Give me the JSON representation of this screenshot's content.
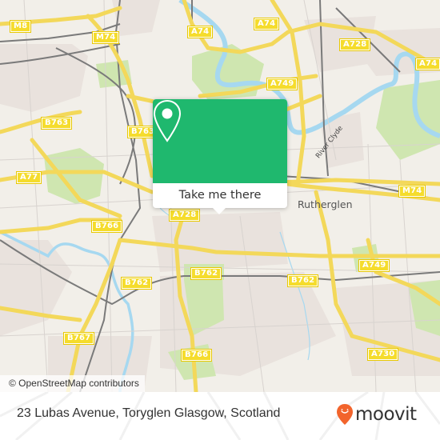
{
  "map": {
    "attribution": "© OpenStreetMap contributors",
    "road_labels": [
      {
        "id": "m8",
        "text": "M8"
      },
      {
        "id": "m74-nw",
        "text": "M74"
      },
      {
        "id": "a74-n",
        "text": "A74"
      },
      {
        "id": "a74-top",
        "text": "A74"
      },
      {
        "id": "a728-ne",
        "text": "A728"
      },
      {
        "id": "a74-ne",
        "text": "A74"
      },
      {
        "id": "a749-n",
        "text": "A749"
      },
      {
        "id": "b763-w",
        "text": "B763"
      },
      {
        "id": "b763-c",
        "text": "B763"
      },
      {
        "id": "a77",
        "text": "A77"
      },
      {
        "id": "m74-e",
        "text": "M74"
      },
      {
        "id": "a728-c",
        "text": "A728"
      },
      {
        "id": "b766-w",
        "text": "B766"
      },
      {
        "id": "a749-se",
        "text": "A749"
      },
      {
        "id": "b762-w",
        "text": "B762"
      },
      {
        "id": "b762-c",
        "text": "B762"
      },
      {
        "id": "b762-e",
        "text": "B762"
      },
      {
        "id": "b767",
        "text": "B767"
      },
      {
        "id": "b766-s",
        "text": "B766"
      },
      {
        "id": "a730",
        "text": "A730"
      }
    ],
    "place_labels": [
      {
        "id": "rutherglen",
        "text": "Rutherglen"
      }
    ],
    "water_labels": [
      {
        "id": "river-clyde",
        "text": "River Clyde"
      }
    ],
    "colors": {
      "land": "#f2efe9",
      "urban": "#e8e0dc",
      "park": "#cfe6b0",
      "water": "#a6d8f0",
      "road_major": "#f7e05a",
      "rail": "#777777"
    }
  },
  "popup": {
    "button_label": "Take me there",
    "icon": "map-pin-icon",
    "accent": "#1fb86e"
  },
  "footer": {
    "address": "23 Lubas Avenue, Toryglen Glasgow, Scotland",
    "brand_name": "moovit",
    "brand_icon": "moovit-smiley-pin-icon",
    "brand_color": "#f2642c"
  }
}
